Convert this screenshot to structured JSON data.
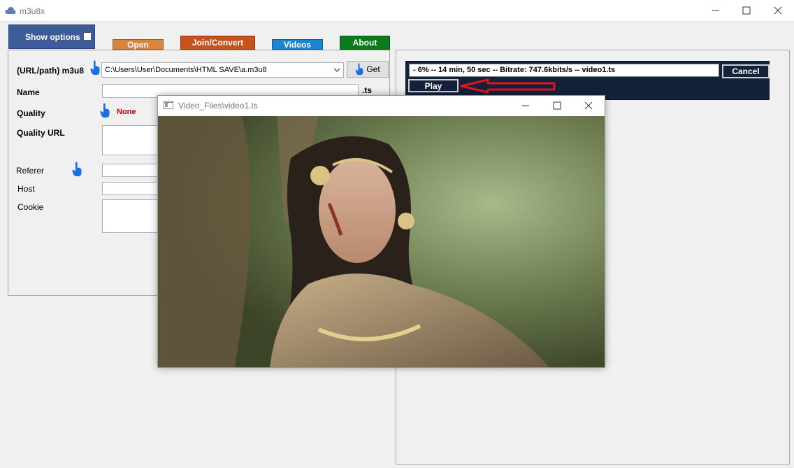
{
  "app": {
    "title": "m3u8x"
  },
  "tabs": {
    "show_options": "Show options",
    "open": "Open",
    "join_convert": "Join/Convert",
    "videos": "Videos",
    "about": "About"
  },
  "form": {
    "url_label": "(URL/path) m3u8",
    "url_value": "C:\\Users\\User\\Documents\\HTML SAVE\\a.m3u8",
    "get_label": "Get",
    "name_label": "Name",
    "name_value": "",
    "ts_suffix": ".ts",
    "quality_label": "Quality",
    "quality_value": "None",
    "quality_url_label": "Quality URL",
    "referer_label": "Referer",
    "host_label": "Host",
    "cookie_label": "Cookie"
  },
  "download": {
    "status": "- 6% -- 14 min, 50 sec -- Bitrate: 747.6kbits/s  -- video1.ts",
    "cancel_label": "Cancel",
    "play_label": "Play"
  },
  "video_window": {
    "title": "Video_Files\\video1.ts"
  },
  "colors": {
    "show_options_tab": "#3e5c9a",
    "open_tab": "#d9853b",
    "join_tab": "#c5531b",
    "videos_tab": "#1a86d0",
    "about_tab": "#0a7c1c",
    "progress_bg": "#13213a",
    "quality_none": "#c00000",
    "arrow": "#e01515"
  },
  "icons": [
    "cloud-icon",
    "hand-pointer-icon",
    "chevron-down-icon",
    "minimize-icon",
    "maximize-icon",
    "close-icon",
    "red-arrow-icon"
  ]
}
